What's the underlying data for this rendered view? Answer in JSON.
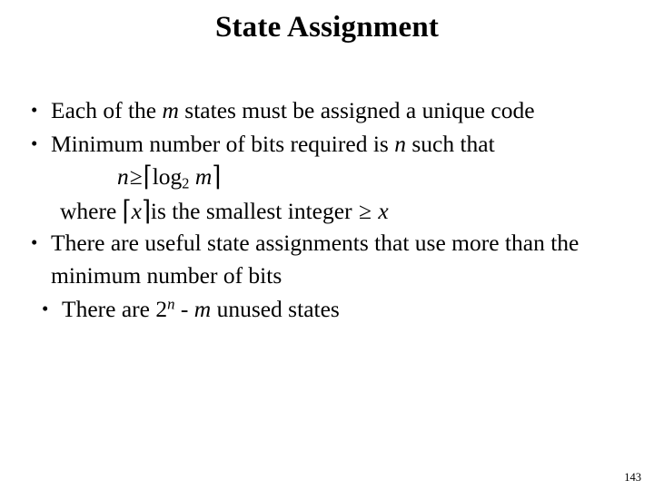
{
  "slide": {
    "title": "State Assignment",
    "page_number": "143",
    "bullet_marker": "•",
    "background_color": "#ffffff",
    "text_color": "#000000",
    "bullets": [
      {
        "id": "unique-code",
        "parts": [
          {
            "text": "Each of the ",
            "style": "normal"
          },
          {
            "text": "m",
            "style": "italic"
          },
          {
            "text": " states must be assigned a unique code",
            "style": "normal"
          }
        ]
      },
      {
        "id": "minimum-bits",
        "parts": [
          {
            "text": "Minimum number of bits required is ",
            "style": "normal"
          },
          {
            "text": "n",
            "style": "italic"
          },
          {
            "text": " such that",
            "style": "normal"
          }
        ]
      },
      {
        "id": "useful-assignments",
        "parts": [
          {
            "text": "There are useful state assignments that use more than the minimum number of bits",
            "style": "normal"
          }
        ]
      },
      {
        "id": "unused-states",
        "extra_indent": true,
        "parts": [
          {
            "text": "There are 2",
            "style": "normal"
          },
          {
            "text": "n",
            "style": "superscript-italic"
          },
          {
            "text": " - ",
            "style": "normal"
          },
          {
            "text": "m",
            "style": "italic"
          },
          {
            "text": " unused states",
            "style": "normal"
          }
        ]
      }
    ],
    "math": {
      "formula": {
        "var_n": "n",
        "operator": "≥",
        "ceil_open": "⌈",
        "log": "log",
        "base": "2",
        "var_m": "m",
        "ceil_close": "⌉"
      },
      "where_clause": {
        "lead": "where ",
        "ceil_open": "⌈",
        "var_x": "x",
        "ceil_close": "⌉",
        "middle": "is the smallest integer ",
        "operator": "≥",
        "trail_var_x": "x"
      }
    }
  }
}
